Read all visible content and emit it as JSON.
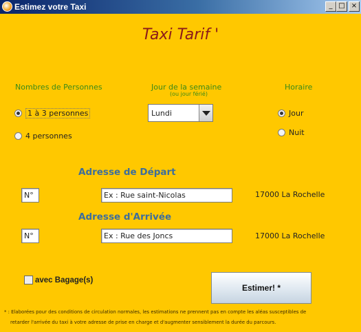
{
  "window": {
    "title": "Estimez votre Taxi",
    "icon": "taxi-app-icon",
    "buttons": {
      "minimize": "_",
      "maximize": "□",
      "close": "×"
    }
  },
  "header": {
    "title": "Taxi Tarif '"
  },
  "persons": {
    "label": "Nombres de Personnes",
    "options": [
      {
        "label": "1 à 3 personnes",
        "selected": true
      },
      {
        "label": "4 personnes",
        "selected": false
      }
    ]
  },
  "day": {
    "label": "Jour de la semaine",
    "sublabel": "(ou jour férié)",
    "selected": "Lundi"
  },
  "schedule": {
    "label": "Horaire",
    "options": [
      {
        "label": "Jour",
        "selected": true
      },
      {
        "label": "Nuit",
        "selected": false
      }
    ]
  },
  "departure": {
    "title": "Adresse de Départ",
    "number_value": "N°",
    "street_value": "Ex : Rue saint-Nicolas",
    "city": "17000 La Rochelle"
  },
  "arrival": {
    "title": "Adresse d'Arrivée",
    "number_value": "N°",
    "street_value": "Ex : Rue des Joncs",
    "city": "17000 La Rochelle"
  },
  "luggage": {
    "label": "avec Bagage(s)",
    "checked": false
  },
  "submit": {
    "label": "Estimer! *"
  },
  "footnote": {
    "line1": "* : Elaborées pour des conditions de circulation normales, les estimations ne prennent pas en compte les aléas susceptibles de",
    "line2": "retarder l'arrivée du taxi à votre adresse de prise en charge et d'augmenter sensiblement la durée du parcours."
  },
  "colors": {
    "background": "#ffc800",
    "title": "#8b1a1a",
    "label_green": "#3a8a18",
    "section_blue": "#3d6e9c"
  }
}
